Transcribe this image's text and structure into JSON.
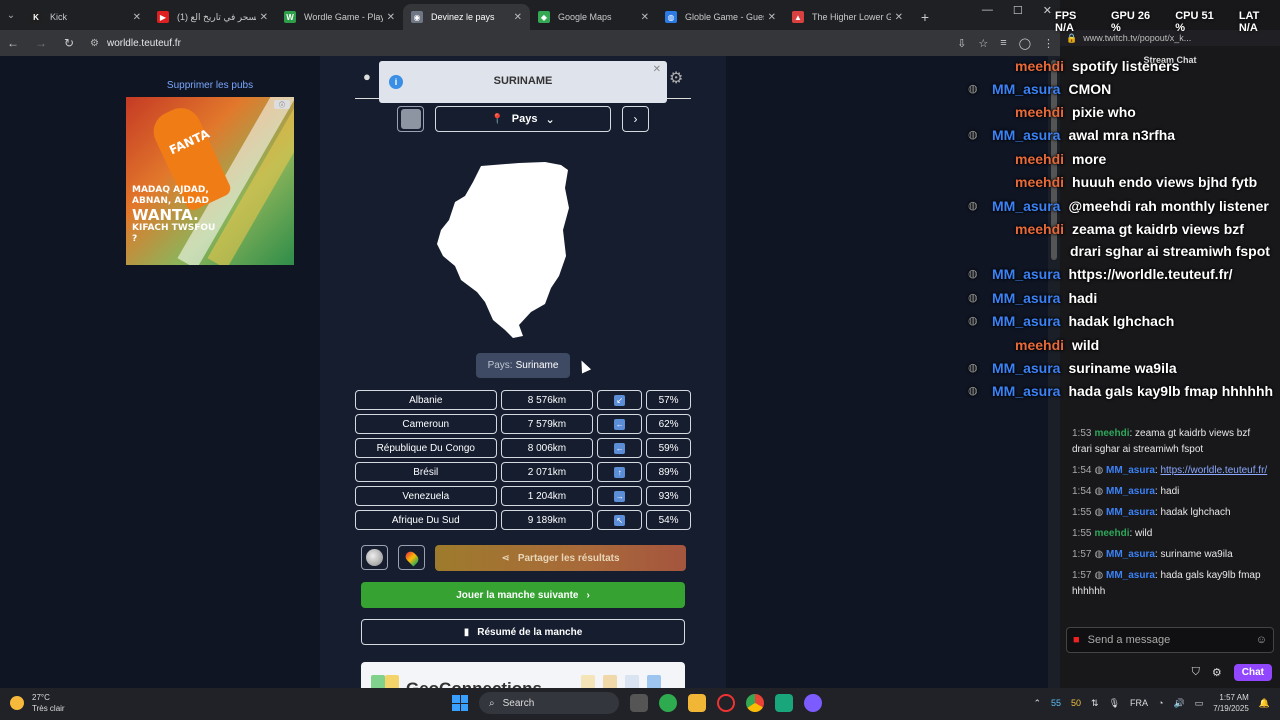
{
  "browser": {
    "tabs": [
      {
        "title": "Kick",
        "color": "#1f1f1f",
        "glyph": "K",
        "active": false
      },
      {
        "title": "(1) السحر في تاريخ الع...",
        "color": "#e02020",
        "glyph": "▶",
        "active": false
      },
      {
        "title": "Wordle Game - Play U...",
        "color": "#2f9e4a",
        "glyph": "W",
        "active": false
      },
      {
        "title": "Devinez le pays",
        "color": "#6f7785",
        "glyph": "◉",
        "active": true
      },
      {
        "title": "Google Maps",
        "color": "#34a853",
        "glyph": "◆",
        "active": false
      },
      {
        "title": "Globle Game - Guess...",
        "color": "#2c7be5",
        "glyph": "◍",
        "active": false
      },
      {
        "title": "The Higher Lower Gam...",
        "color": "#d94040",
        "glyph": "▲",
        "active": false
      }
    ],
    "url": "worldle.teuteuf.fr"
  },
  "ad": {
    "link_text": "Supprimer les pubs",
    "fanta_text": "FANTA",
    "slogan_line1": "MADAQ AJDAD, ABNAN, ALDAD",
    "slogan_big": "WANTA.",
    "slogan_line2": "KIFACH TWSFOU ?"
  },
  "game": {
    "toast_title": "SURINAME",
    "mode_label": "Pays",
    "answer_prefix": "Pays:",
    "answer_value": "Suriname",
    "guesses": [
      {
        "country": "Albanie",
        "distance": "8 576km",
        "direction": "↙",
        "percent": "57%"
      },
      {
        "country": "Cameroun",
        "distance": "7 579km",
        "direction": "←",
        "percent": "62%"
      },
      {
        "country": "République Du Congo",
        "distance": "8 006km",
        "direction": "←",
        "percent": "59%"
      },
      {
        "country": "Brésil",
        "distance": "2 071km",
        "direction": "↑",
        "percent": "89%"
      },
      {
        "country": "Venezuela",
        "distance": "1 204km",
        "direction": "→",
        "percent": "93%"
      },
      {
        "country": "Afrique Du Sud",
        "distance": "9 189km",
        "direction": "↖",
        "percent": "54%"
      }
    ],
    "share_label": "Partager les résultats",
    "next_round_label": "Jouer la manche suivante",
    "summary_label": "Résumé de la manche",
    "geo_title": "GeoConnections"
  },
  "stats": {
    "fps": "FPS N/A",
    "gpu": "GPU 26 %",
    "cpu": "CPU 51 %",
    "lat": "LAT N/A"
  },
  "overlay": [
    {
      "name": "meehdi",
      "kind": "me",
      "text": "spotify listeners"
    },
    {
      "name": "MM_asura",
      "kind": "mm",
      "text": "CMON"
    },
    {
      "name": "meehdi",
      "kind": "me",
      "text": "pixie who"
    },
    {
      "name": "MM_asura",
      "kind": "mm",
      "text": "awal mra n3rfha"
    },
    {
      "name": "meehdi",
      "kind": "me",
      "text": "more"
    },
    {
      "name": "meehdi",
      "kind": "me",
      "text": "huuuh endo views bjhd fytb"
    },
    {
      "name": "MM_asura",
      "kind": "mm",
      "text": "@meehdi rah monthly listener"
    },
    {
      "name": "meehdi",
      "kind": "me",
      "text": "zeama gt kaidrb views bzf"
    },
    {
      "name": "",
      "kind": "me",
      "text": "drari sghar ai streamiwh fspot"
    },
    {
      "name": "MM_asura",
      "kind": "mm",
      "text": "https://worldle.teuteuf.fr/"
    },
    {
      "name": "MM_asura",
      "kind": "mm",
      "text": "hadi"
    },
    {
      "name": "MM_asura",
      "kind": "mm",
      "text": "hadak lghchach"
    },
    {
      "name": "meehdi",
      "kind": "me",
      "text": "wild"
    },
    {
      "name": "MM_asura",
      "kind": "mm",
      "text": "suriname wa9ila"
    },
    {
      "name": "MM_asura",
      "kind": "mm",
      "text": "hada gals kay9lb fmap hhhhhh"
    }
  ],
  "chat": {
    "url": "www.twitch.tv/popout/x_k...",
    "header": "Stream Chat",
    "messages": [
      {
        "time": "1:53",
        "user": "meehdi",
        "kind": "me",
        "text": "zeama gt kaidrb views bzf drari sghar ai streamiwh fspot"
      },
      {
        "time": "1:54",
        "user": "MM_asura",
        "kind": "mm",
        "text": "https://worldle.teuteuf.fr/"
      },
      {
        "time": "1:54",
        "user": "MM_asura",
        "kind": "mm",
        "text": "hadi"
      },
      {
        "time": "1:55",
        "user": "MM_asura",
        "kind": "mm",
        "text": "hadak lghchach"
      },
      {
        "time": "1:55",
        "user": "meehdi",
        "kind": "me",
        "text": "wild"
      },
      {
        "time": "1:57",
        "user": "MM_asura",
        "kind": "mm",
        "text": "suriname wa9ila"
      },
      {
        "time": "1:57",
        "user": "MM_asura",
        "kind": "mm",
        "text": "hada gals kay9lb fmap hhhhhh"
      }
    ],
    "input_placeholder": "Send a message",
    "chat_button": "Chat"
  },
  "taskbar": {
    "temp": "27°C",
    "weather": "Très clair",
    "search": "Search",
    "lang": "FRA",
    "time": "1:57 AM",
    "date": "7/19/2025",
    "tray_a": "55",
    "tray_b": "50"
  }
}
